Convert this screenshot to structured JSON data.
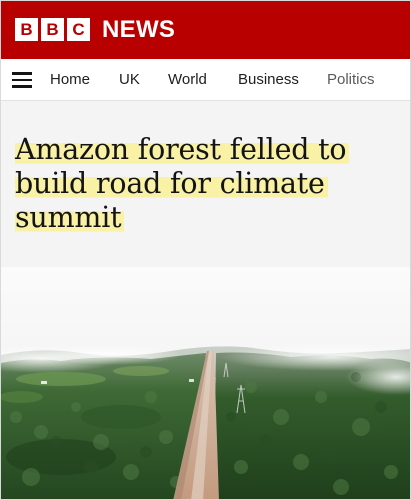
{
  "header": {
    "brand_blocks": [
      "B",
      "B",
      "C"
    ],
    "brand_word": "NEWS",
    "brand_color": "#b80000"
  },
  "nav": {
    "menu_icon": "hamburger-menu-icon",
    "items": [
      {
        "label": "Home"
      },
      {
        "label": "UK"
      },
      {
        "label": "World"
      },
      {
        "label": "Business"
      },
      {
        "label": "Politics"
      }
    ]
  },
  "article": {
    "headline": "Amazon forest felled to build road for climate summit",
    "highlight_color": "#f8f1a6"
  },
  "hero_image": {
    "subject": "aerial-forest-road-photo"
  }
}
